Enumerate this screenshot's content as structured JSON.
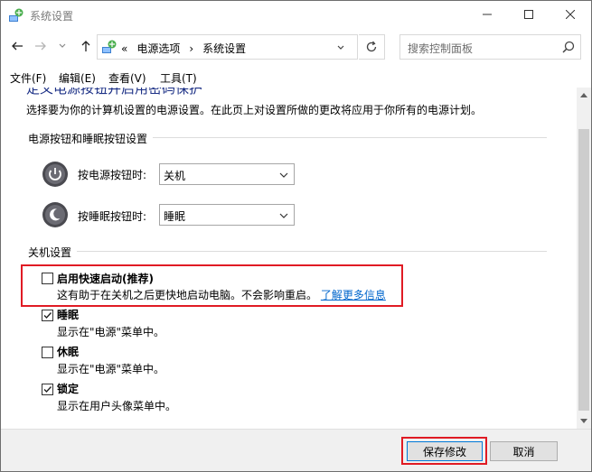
{
  "window": {
    "title": "系统设置"
  },
  "nav": {
    "breadcrumb_prefix": "«",
    "breadcrumbs": [
      "电源选项",
      "系统设置"
    ],
    "search_placeholder": "搜索控制面板"
  },
  "menubar": {
    "items": [
      "文件(F)",
      "编辑(E)",
      "查看(V)",
      "工具(T)"
    ]
  },
  "content": {
    "heading_partial": "定义电源按钮并启用密码保护",
    "description": "选择要为你的计算机设置的电源设置。在此页上对设置所做的更改将应用于你所有的电源计划。",
    "power_section": {
      "title": "电源按钮和睡眠按钮设置",
      "power_button": {
        "label": "按电源按钮时:",
        "value": "关机"
      },
      "sleep_button": {
        "label": "按睡眠按钮时:",
        "value": "睡眠"
      }
    },
    "shutdown_section": {
      "title": "关机设置",
      "options": [
        {
          "title": "启用快速启动(推荐)",
          "desc": "这有助于在关机之后更快地启动电脑。不会影响重启。",
          "link": "了解更多信息",
          "checked": false
        },
        {
          "title": "睡眠",
          "desc": "显示在\"电源\"菜单中。",
          "checked": true
        },
        {
          "title": "休眠",
          "desc": "显示在\"电源\"菜单中。",
          "checked": false
        },
        {
          "title": "锁定",
          "desc": "显示在用户头像菜单中。",
          "checked": true
        }
      ]
    }
  },
  "footer": {
    "save_label": "保存修改",
    "cancel_label": "取消"
  },
  "colors": {
    "highlight": "#e01b24",
    "link": "#0066cc",
    "heading": "#1e3287",
    "primary_border": "#0078d7"
  }
}
